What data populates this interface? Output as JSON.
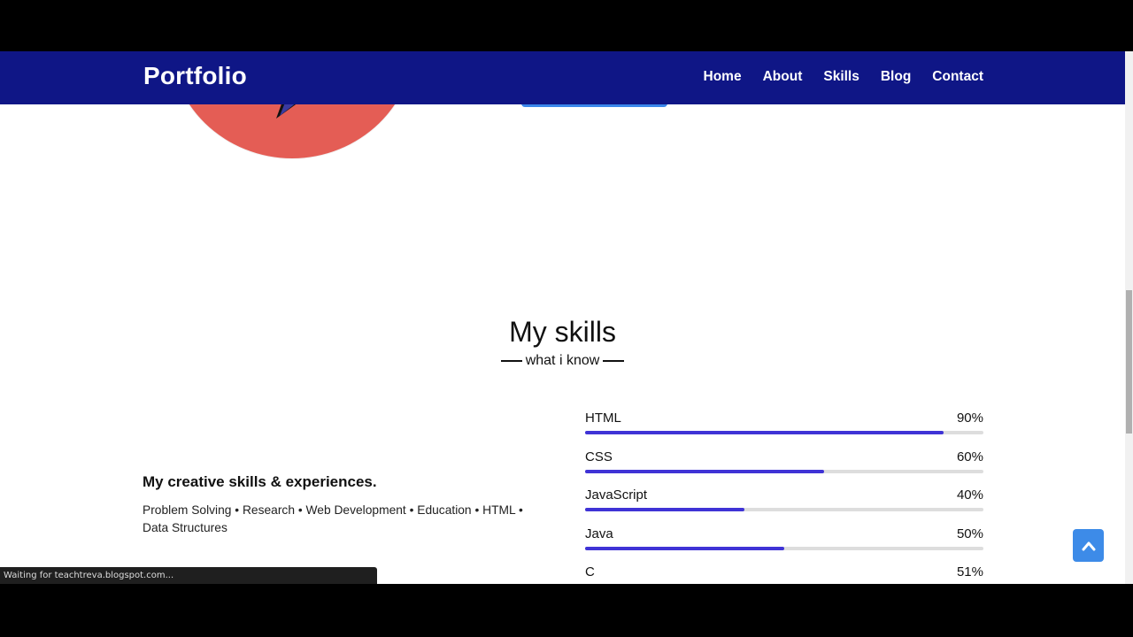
{
  "brand": "Portfolio",
  "nav": [
    {
      "label": "Home"
    },
    {
      "label": "About"
    },
    {
      "label": "Skills"
    },
    {
      "label": "Blog"
    },
    {
      "label": "Contact"
    }
  ],
  "skills": {
    "title": "My skills",
    "subtitle": "what i know",
    "heading": "My creative skills & experiences.",
    "description": "Problem Solving • Research • Web Development • Education • HTML • Data Structures",
    "bars": [
      {
        "name": "HTML",
        "percent_label": "90%",
        "value": 90
      },
      {
        "name": "CSS",
        "percent_label": "60%",
        "value": 60
      },
      {
        "name": "JavaScript",
        "percent_label": "40%",
        "value": 40
      },
      {
        "name": "Java",
        "percent_label": "50%",
        "value": 50
      },
      {
        "name": "C",
        "percent_label": "51%",
        "value": 51
      }
    ]
  },
  "status_bar": "Waiting for teachtreva.blogspot.com...",
  "colors": {
    "navbar": "#0f1686",
    "bar_fill": "#3f33d6",
    "hero_circle": "#e45d55",
    "scroll_top_button": "#3d8be8"
  },
  "icons": {
    "scroll_top": "chevron-up-icon"
  }
}
